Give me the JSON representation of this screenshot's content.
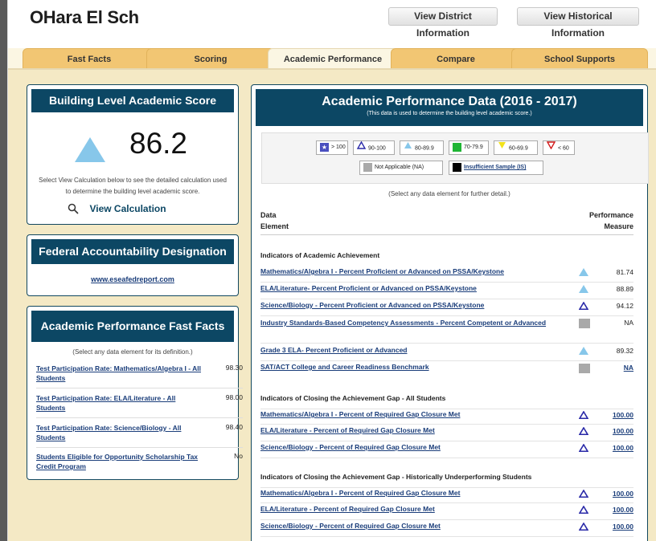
{
  "header": {
    "school_name": "OHara El Sch",
    "district_button": "View District Information",
    "historical_button": "View Historical Information"
  },
  "tabs": [
    "Fast Facts",
    "Scoring",
    "Academic Performance",
    "Compare",
    "School Supports"
  ],
  "building_score": {
    "title": "Building Level Academic Score",
    "score": "86.2",
    "description": "Select View Calculation below to see the detailed calculation used to determine the building level academic score.",
    "view_calc": "View Calculation"
  },
  "federal": {
    "title": "Federal Accountability Designation",
    "link": "www.eseafedreport.com"
  },
  "fast_facts": {
    "title": "Academic Performance Fast Facts",
    "note": "(Select any data element for its definition.)",
    "rows": [
      {
        "name": "Test Participation Rate: Mathematics/Algebra I - All Students",
        "value": "98.30"
      },
      {
        "name": "Test Participation Rate: ELA/Literature - All Students",
        "value": "98.00"
      },
      {
        "name": "Test Participation Rate: Science/Biology - All Students",
        "value": "98.40"
      },
      {
        "name": "Students Eligible for Opportunity Scholarship Tax Credit Program",
        "value": "No"
      }
    ]
  },
  "performance": {
    "title": "Academic Performance Data (2016 - 2017)",
    "subtitle": "(This data is used to determine the building level academic score.)",
    "legend": {
      "gt100": "> 100",
      "r90": "90-100",
      "r80": "80-89.9",
      "r70": "70-79.9",
      "r60": "60-69.9",
      "lt60": "< 60",
      "na": "Not Applicable (NA)",
      "is": "Insufficient Sample (IS)"
    },
    "select_note": "(Select any data element for further detail.)",
    "col_data": "Data",
    "col_element": "Element",
    "col_perf": "Performance",
    "col_measure": "Measure",
    "sections": [
      {
        "title": "Indicators of Academic Achievement",
        "rows": [
          {
            "name": "Mathematics/Algebra I - Percent Proficient or Advanced on PSSA/Keystone",
            "icon": "light-blue-triangle-icon",
            "value": "81.74"
          },
          {
            "name": "ELA/Literature- Percent Proficient or Advanced on PSSA/Keystone",
            "icon": "light-blue-triangle-icon",
            "value": "88.89"
          },
          {
            "name": "Science/Biology - Percent Proficient or Advanced on PSSA/Keystone",
            "icon": "outline-triangle-icon",
            "value": "94.12"
          },
          {
            "name": "Industry Standards-Based Competency Assessments - Percent Competent or Advanced",
            "icon": "gray-square-icon",
            "value": "NA"
          },
          {
            "name": "Grade 3 ELA- Percent Proficient or Advanced",
            "icon": "light-blue-triangle-icon",
            "value": "89.32"
          },
          {
            "name": "SAT/ACT College and Career Readiness Benchmark",
            "icon": "gray-square-icon",
            "value": "NA"
          }
        ]
      },
      {
        "title": "Indicators of Closing the Achievement Gap - All Students",
        "rows": [
          {
            "name": "Mathematics/Algebra I - Percent of Required Gap Closure Met",
            "icon": "outline-triangle-icon",
            "value": "100.00"
          },
          {
            "name": "ELA/Literature - Percent of Required Gap Closure Met",
            "icon": "outline-triangle-icon",
            "value": "100.00"
          },
          {
            "name": "Science/Biology - Percent of Required Gap Closure Met",
            "icon": "outline-triangle-icon",
            "value": "100.00"
          }
        ]
      },
      {
        "title": "Indicators of Closing the Achievement Gap - Historically Underperforming Students",
        "rows": [
          {
            "name": "Mathematics/Algebra I - Percent of Required Gap Closure Met",
            "icon": "outline-triangle-icon",
            "value": "100.00"
          },
          {
            "name": "ELA/Literature - Percent of Required Gap Closure Met",
            "icon": "outline-triangle-icon",
            "value": "100.00"
          },
          {
            "name": "Science/Biology - Percent of Required Gap Closure Met",
            "icon": "outline-triangle-icon",
            "value": "100.00"
          }
        ]
      }
    ]
  },
  "colors": {
    "navy": "#0c4764",
    "light_blue": "#87c7ea",
    "outline_blue": "#2a2aa8",
    "gray": "#a9a9a9",
    "tab": "#f2c673"
  }
}
